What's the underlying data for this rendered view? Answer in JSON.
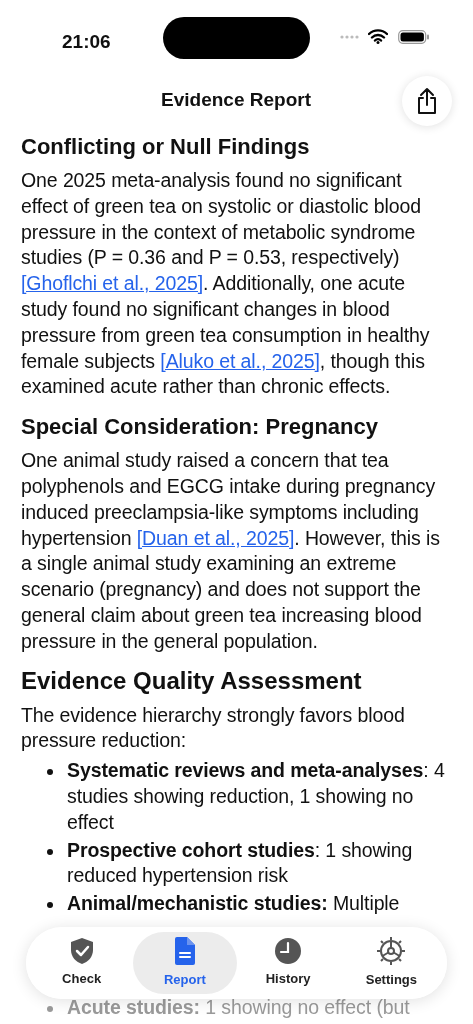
{
  "status_bar": {
    "time": "21:06"
  },
  "nav": {
    "title": "Evidence Report"
  },
  "sections": [
    {
      "heading": "Conflicting or Null Findings",
      "kind": "subheading",
      "paragraphs": [
        [
          {
            "kind": "text",
            "text": "One 2025 meta-analysis found no significant effect of green tea on systolic or diastolic blood pressure in the context of metabolic syndrome studies (P = 0.36 and P = 0.53, respectively) "
          },
          {
            "kind": "link",
            "text": "[Ghoflchi et al., 2025]"
          },
          {
            "kind": "text",
            "text": ". Additionally, one acute study found no significant changes in blood pressure from green tea consumption in healthy female subjects "
          },
          {
            "kind": "link",
            "text": "[Aluko et al., 2025]"
          },
          {
            "kind": "text",
            "text": ", though this examined acute rather than chronic effects."
          }
        ]
      ]
    },
    {
      "heading": "Special Consideration: Pregnancy",
      "kind": "subheading",
      "paragraphs": [
        [
          {
            "kind": "text",
            "text": "One animal study raised a concern that tea polyphenols and EGCG intake during pregnancy induced preeclampsia-like symptoms including hypertension "
          },
          {
            "kind": "link",
            "text": "[Duan et al., 2025]"
          },
          {
            "kind": "text",
            "text": ". However, this is a single animal study examining an extreme scenario (pregnancy) and does not support the general claim about green tea increasing blood pressure in the general population."
          }
        ]
      ]
    },
    {
      "heading": "Evidence Quality Assessment",
      "kind": "heading",
      "paragraphs": [
        [
          {
            "kind": "text",
            "text": "The evidence hierarchy strongly favors blood pressure reduction:"
          }
        ]
      ],
      "bullets": [
        "**Systematic reviews and meta-analyses**: 4 studies showing reduction, 1 showing no effect",
        "**Prospective cohort studies**: 1 showing reduced hypertension risk",
        "**Animal/mechanistic studies:** Multiple",
        "**Acute studies:** 1 showing no effect (but"
      ]
    }
  ],
  "tab_bar": [
    {
      "label": "Check",
      "selected": false
    },
    {
      "label": "Report",
      "selected": true
    },
    {
      "label": "History",
      "selected": false
    },
    {
      "label": "Settings",
      "selected": false
    }
  ]
}
